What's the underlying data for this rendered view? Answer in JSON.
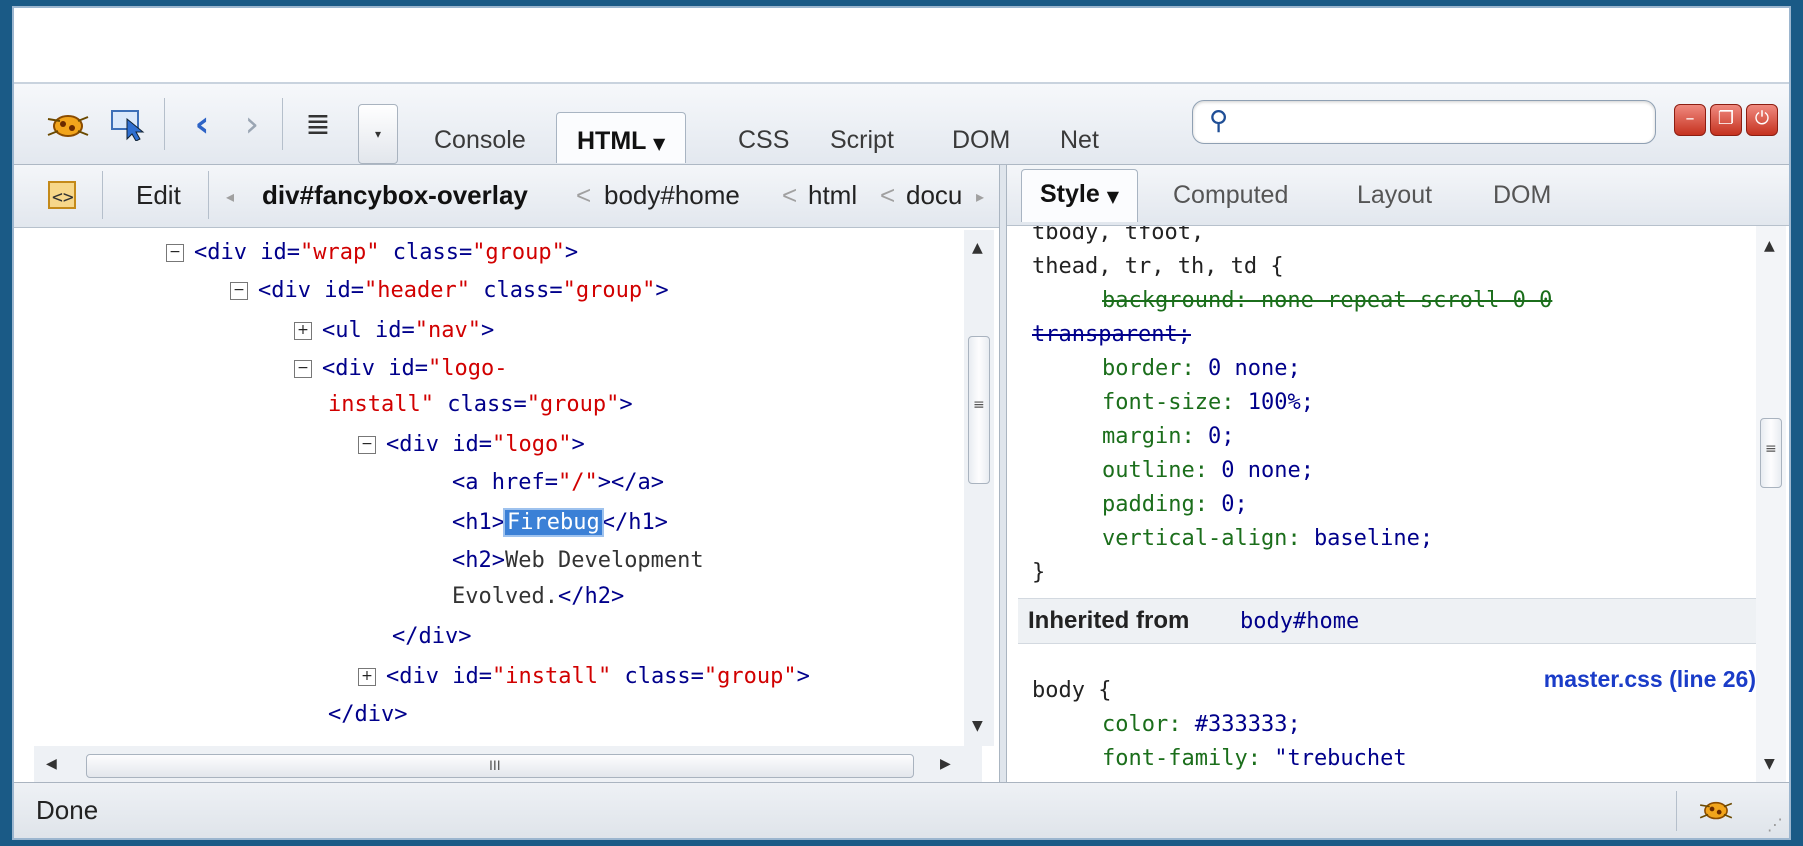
{
  "toolbar": {
    "tabs": [
      {
        "label": "Console",
        "active": false
      },
      {
        "label": "HTML",
        "active": true
      },
      {
        "label": "CSS",
        "active": false
      },
      {
        "label": "Script",
        "active": false
      },
      {
        "label": "DOM",
        "active": false
      },
      {
        "label": "Net",
        "active": false
      }
    ],
    "search_placeholder": ""
  },
  "left_panel": {
    "edit_label": "Edit",
    "breadcrumbs": [
      "div#fancybox-overlay",
      "body#home",
      "html",
      "docu"
    ]
  },
  "right_panel": {
    "tabs": [
      {
        "label": "Style",
        "active": true
      },
      {
        "label": "Computed",
        "active": false
      },
      {
        "label": "Layout",
        "active": false
      },
      {
        "label": "DOM",
        "active": false
      }
    ],
    "selector_lines": [
      "tbody, tfoot,",
      "thead, tr, th, td {"
    ],
    "overridden": [
      "background: none repeat scroll 0 0",
      "transparent;"
    ],
    "properties": [
      {
        "name": "border",
        "value": "0 none;"
      },
      {
        "name": "font-size",
        "value": "100%;"
      },
      {
        "name": "margin",
        "value": "0;"
      },
      {
        "name": "outline",
        "value": "0 none;"
      },
      {
        "name": "padding",
        "value": "0;"
      },
      {
        "name": "vertical-align",
        "value": "baseline;"
      }
    ],
    "close_brace": "}",
    "inherited_label": "Inherited from",
    "inherited_selector": "body#home",
    "source_link": "master.css (line 26)",
    "body_rule": {
      "selector": "body {",
      "properties": [
        {
          "name": "color",
          "value": "#333333;"
        },
        {
          "name": "font-family",
          "value": "\"trebuchet"
        }
      ]
    }
  },
  "status": {
    "text": "Done"
  }
}
